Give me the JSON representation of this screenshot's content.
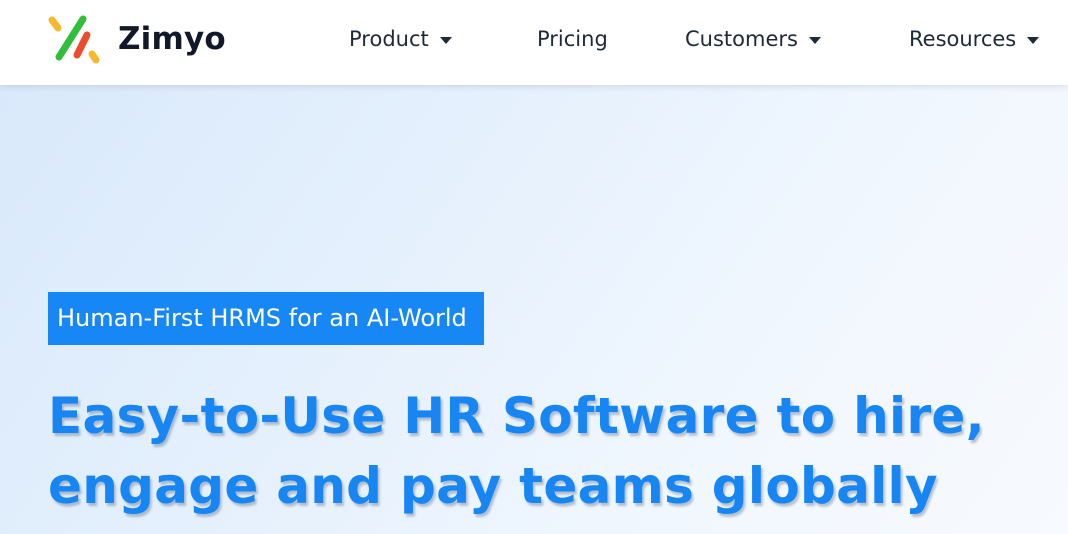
{
  "header": {
    "logo_text": "Zimyo",
    "nav": [
      {
        "label": "Product",
        "has_dropdown": true
      },
      {
        "label": "Pricing",
        "has_dropdown": false
      },
      {
        "label": "Customers",
        "has_dropdown": true
      },
      {
        "label": "Resources",
        "has_dropdown": true
      }
    ]
  },
  "hero": {
    "tagline": "Human-First HRMS for an AI-World",
    "headline_line1": "Easy-to-Use HR Software to hire,",
    "headline_line2": "engage and pay teams globally"
  },
  "colors": {
    "accent": "#1787f5",
    "headline": "#1786f3",
    "nav_text": "#1f2937",
    "logo_yellow": "#f5b82e",
    "logo_green": "#2fbf3a",
    "logo_blue": "#1f84f0",
    "logo_red": "#ea4c2c"
  }
}
